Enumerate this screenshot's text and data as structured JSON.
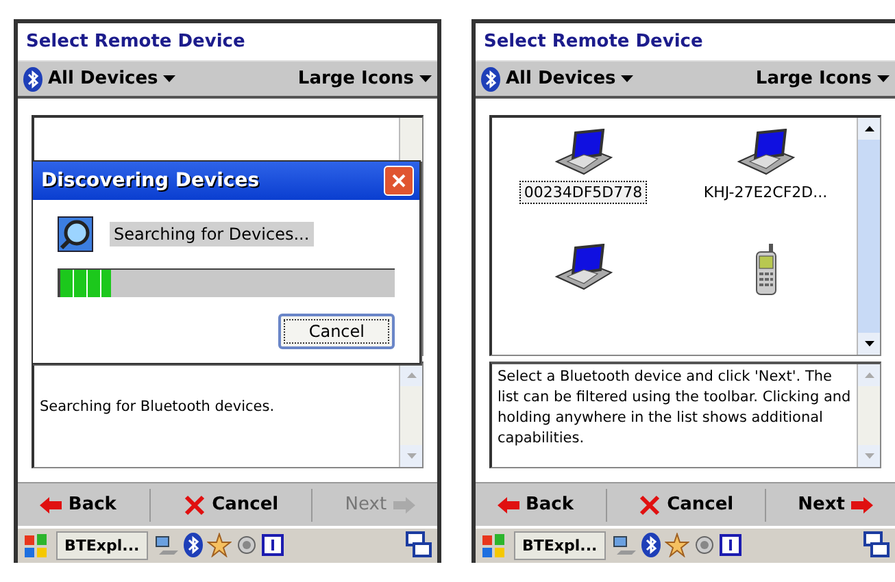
{
  "screens": [
    {
      "title": "Select Remote Device",
      "filter": "All Devices",
      "view": "Large Icons",
      "dialog": {
        "title": "Discovering Devices",
        "message": "Searching for Devices...",
        "level": 0.15,
        "button": "Cancel"
      },
      "description": "Searching for Bluetooth devices.",
      "buttons": [
        {
          "kind": "back",
          "label": "Back",
          "disabled": false
        },
        {
          "kind": "cancel",
          "label": "Cancel",
          "disabled": false
        },
        {
          "kind": "next",
          "label": "Next",
          "disabled": true
        }
      ],
      "taskbar_app": "BTExpl..."
    },
    {
      "title": "Select Remote Device",
      "filter": "All Devices",
      "view": "Large Icons",
      "devices": [
        {
          "kind": "laptop",
          "name": "00234DF5D778",
          "selected": true
        },
        {
          "kind": "laptop",
          "name": "KHJ-27E2CF2D...",
          "selected": false
        },
        {
          "kind": "laptop"
        },
        {
          "kind": "phone"
        }
      ],
      "description": "Select a Bluetooth device and click 'Next'. The list can be filtered using the toolbar. Clicking and holding anywhere in the list shows additional capabilities.",
      "buttons": [
        {
          "kind": "back",
          "label": "Back",
          "disabled": false
        },
        {
          "kind": "cancel",
          "label": "Cancel",
          "disabled": false
        },
        {
          "kind": "next",
          "label": "Next",
          "disabled": false
        }
      ],
      "taskbar_app": "BTExpl..."
    }
  ]
}
